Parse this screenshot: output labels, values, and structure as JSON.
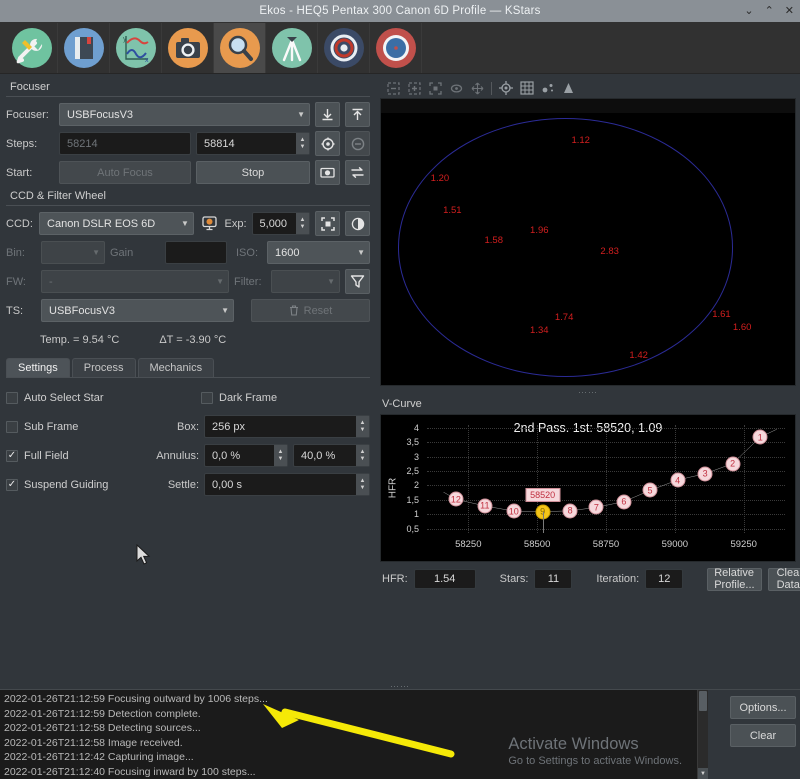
{
  "window": {
    "title": "Ekos - HEQ5 Pentax 300 Canon 6D Profile — KStars",
    "controls": {
      "minimize": "⌄",
      "maximize": "⌃",
      "close": "✕"
    }
  },
  "toolbar": {
    "items": [
      {
        "name": "setup-tab",
        "icon": "wrench-screwdriver-icon",
        "active": false
      },
      {
        "name": "scheduler-tab",
        "icon": "notebook-icon",
        "active": false
      },
      {
        "name": "analyze-tab",
        "icon": "graph-icon",
        "active": false
      },
      {
        "name": "capture-tab",
        "icon": "camera-icon",
        "active": false
      },
      {
        "name": "focus-tab",
        "icon": "magnifier-icon",
        "active": true
      },
      {
        "name": "align-tab",
        "icon": "tripod-icon",
        "active": false
      },
      {
        "name": "guide-tab",
        "icon": "target-icon",
        "active": false
      },
      {
        "name": "mount-tab",
        "icon": "compass-icon",
        "active": false
      }
    ]
  },
  "focuser": {
    "group_label": "Focuser",
    "device_label": "Focuser:",
    "device_value": "USBFocusV3",
    "steps_label": "Steps:",
    "steps_current": "58214",
    "steps_target": "58814",
    "start_label": "Start:",
    "autofocus_button": "Auto Focus",
    "stop_button": "Stop",
    "focus_in_icon": "arrow-down-icon",
    "focus_out_icon": "arrow-up-icon",
    "goto_icon": "target-circle-icon",
    "stop_motion_icon": "minus-circle-icon",
    "capture_icon": "capture-frame-icon",
    "loop_icon": "loop-icon"
  },
  "ccd": {
    "group_label": "CCD & Filter Wheel",
    "ccd_label": "CCD:",
    "ccd_value": "Canon DSLR EOS 6D",
    "ccd_settings_icon": "ccd-settings-icon",
    "exp_label": "Exp:",
    "exp_value": "5,000",
    "frame_icon": "frame-icon",
    "preview_icon": "preview-icon",
    "bin_label": "Bin:",
    "bin_value": "",
    "gain_label": "Gain",
    "gain_value": "",
    "iso_label": "ISO:",
    "iso_value": "1600",
    "fw_label": "FW:",
    "fw_value": "-",
    "filter_label": "Filter:",
    "filter_value": "",
    "filter_icon": "filter-funnel-icon",
    "ts_label": "TS:",
    "ts_value": "USBFocusV3",
    "reset_button": "Reset",
    "reset_icon": "trash-icon",
    "temp_text": "Temp. = 9.54 °C",
    "delta_text": "ΔT = -3.90 °C"
  },
  "tabs": [
    {
      "label": "Settings",
      "accesskey": "S",
      "active": true
    },
    {
      "label": "Process",
      "accesskey": "P",
      "active": false
    },
    {
      "label": "Mechanics",
      "accesskey": "M",
      "active": false
    }
  ],
  "settings": {
    "auto_select_star": {
      "label": "Auto Select Star",
      "checked": false
    },
    "dark_frame": {
      "label": "Dark Frame",
      "checked": false
    },
    "sub_frame": {
      "label": "Sub Frame",
      "checked": false
    },
    "full_field": {
      "label": "Full Field",
      "checked": true
    },
    "suspend_guiding": {
      "label": "Suspend Guiding",
      "checked": true
    },
    "box_label": "Box:",
    "box_value": "256 px",
    "annulus_label": "Annulus:",
    "annulus_min": "0,0 %",
    "annulus_max": "40,0 %",
    "settle_label": "Settle:",
    "settle_value": "0,00 s"
  },
  "preview": {
    "toolbar_icons": [
      "zoom-out-icon",
      "zoom-in-icon",
      "zoom-fit-icon",
      "zoom-default-icon",
      "pan-icon",
      "crosshair-icon",
      "grid-icon",
      "stars-icon",
      "histogram-icon"
    ],
    "hfr_markers": [
      {
        "value": "1.12",
        "x": 46,
        "y": 8
      },
      {
        "value": "1.20",
        "x": 12,
        "y": 28
      },
      {
        "value": "1.51",
        "x": 16,
        "y": 44
      },
      {
        "value": "1.58",
        "x": 25,
        "y": 58
      },
      {
        "value": "1.96",
        "x": 37,
        "y": 52
      },
      {
        "value": "2.83",
        "x": 54,
        "y": 63
      },
      {
        "value": "1.74",
        "x": 44,
        "y": 80
      },
      {
        "value": "1.34",
        "x": 38,
        "y": 85
      },
      {
        "value": "1.42",
        "x": 62,
        "y": 94
      },
      {
        "value": "1.61",
        "x": 83,
        "y": 79
      },
      {
        "value": "1.60",
        "x": 88,
        "y": 83
      }
    ]
  },
  "vcurve": {
    "group_label": "V-Curve",
    "hfr_label": "HFR:",
    "hfr_value": "1.54",
    "stars_label": "Stars:",
    "stars_value": "11",
    "iteration_label": "Iteration:",
    "iteration_value": "12",
    "relative_profile_button": "Relative Profile...",
    "clear_data_button": "Clear Data"
  },
  "chart_data": {
    "type": "scatter",
    "title": "2nd Pass. 1st: 58520,  1.09",
    "xlabel": "",
    "ylabel": "HFR",
    "xlim": [
      58100,
      59400
    ],
    "ylim": [
      0.35,
      4.1
    ],
    "xticks": [
      58250,
      58500,
      58750,
      59000,
      59250
    ],
    "yticks": [
      0.5,
      1,
      1.5,
      2,
      2.5,
      3,
      3.5,
      4
    ],
    "grid": true,
    "legend": false,
    "cursor_label": "58520",
    "cursor_x": 58520,
    "points": [
      {
        "label": "12",
        "x": 58205,
        "y": 1.52
      },
      {
        "label": "11",
        "x": 58310,
        "y": 1.29
      },
      {
        "label": "10",
        "x": 58415,
        "y": 1.11
      },
      {
        "label": "9",
        "x": 58520,
        "y": 1.09,
        "current": true
      },
      {
        "label": "8",
        "x": 58620,
        "y": 1.12
      },
      {
        "label": "7",
        "x": 58715,
        "y": 1.24
      },
      {
        "label": "6",
        "x": 58815,
        "y": 1.44
      },
      {
        "label": "5",
        "x": 58910,
        "y": 1.83
      },
      {
        "label": "4",
        "x": 59010,
        "y": 2.19
      },
      {
        "label": "3",
        "x": 59110,
        "y": 2.41
      },
      {
        "label": "2",
        "x": 59210,
        "y": 2.76
      },
      {
        "label": "1",
        "x": 59310,
        "y": 3.68
      }
    ]
  },
  "log": {
    "lines": [
      "2022-01-26T21:12:59 Focusing outward by 1006 steps...",
      "2022-01-26T21:12:59 Detection complete.",
      "2022-01-26T21:12:58 Detecting sources...",
      "2022-01-26T21:12:58 Image received.",
      "2022-01-26T21:12:42 Capturing image...",
      "2022-01-26T21:12:40 Focusing inward by 100 steps..."
    ],
    "options_button": "Options...",
    "clear_button": "Clear"
  },
  "watermark": {
    "line1": "Activate Windows",
    "line2": "Go to Settings to activate Windows."
  },
  "colors": {
    "accent_orange": "#e08b3a",
    "hfr_red": "#d31f1f",
    "current_point": "#f5c518",
    "annotation_arrow": "#f5e907"
  }
}
